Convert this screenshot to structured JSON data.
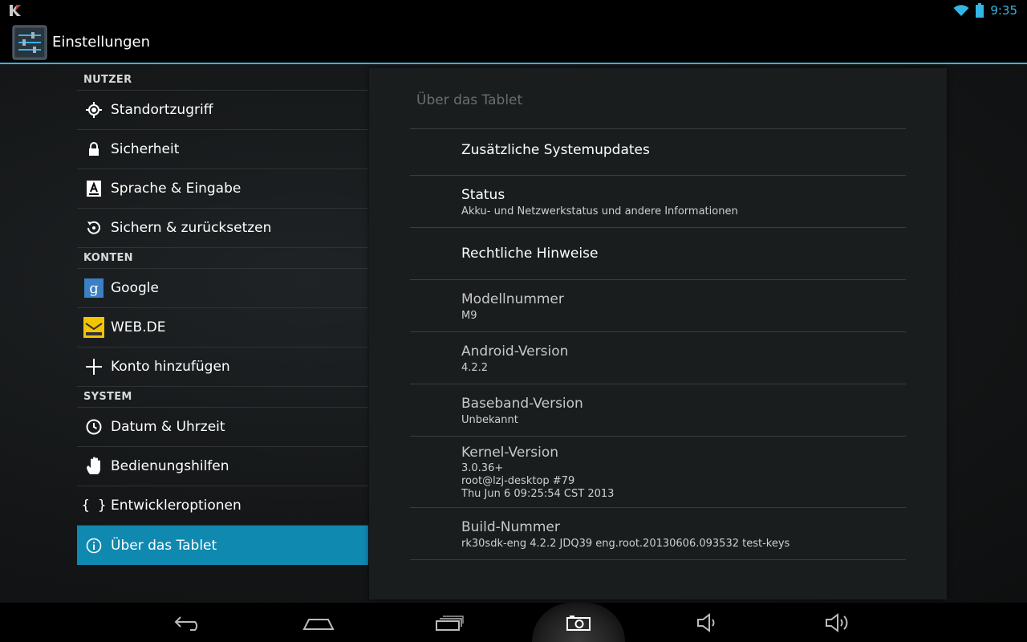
{
  "statusbar": {
    "time": "9:35"
  },
  "actionbar": {
    "title": "Einstellungen"
  },
  "sidebar": {
    "sections": [
      {
        "header": "NUTZER",
        "items": [
          {
            "label": "Standortzugriff",
            "icon": "location-icon"
          },
          {
            "label": "Sicherheit",
            "icon": "lock-icon"
          },
          {
            "label": "Sprache & Eingabe",
            "icon": "keyboard-a-icon"
          },
          {
            "label": "Sichern & zurücksetzen",
            "icon": "restore-icon"
          }
        ]
      },
      {
        "header": "KONTEN",
        "items": [
          {
            "label": "Google",
            "icon": "google-icon"
          },
          {
            "label": "WEB.DE",
            "icon": "webde-icon"
          },
          {
            "label": "Konto hinzufügen",
            "icon": "plus-icon"
          }
        ]
      },
      {
        "header": "SYSTEM",
        "items": [
          {
            "label": "Datum & Uhrzeit",
            "icon": "clock-icon"
          },
          {
            "label": "Bedienungshilfen",
            "icon": "hand-icon"
          },
          {
            "label": "Entwickleroptionen",
            "icon": "braces-icon"
          },
          {
            "label": "Über das Tablet",
            "icon": "info-icon",
            "selected": true
          }
        ]
      }
    ]
  },
  "detail": {
    "title": "Über das Tablet",
    "rows": [
      {
        "title": "Zusätzliche Systemupdates"
      },
      {
        "title": "Status",
        "summary": "Akku- und Netzwerkstatus und andere Informationen"
      },
      {
        "title": "Rechtliche Hinweise"
      },
      {
        "title": "Modellnummer",
        "summary": "M9"
      },
      {
        "title": "Android-Version",
        "summary": "4.2.2"
      },
      {
        "title": "Baseband-Version",
        "summary": "Unbekannt"
      },
      {
        "title": "Kernel-Version",
        "summary_lines": [
          "3.0.36+",
          "root@lzj-desktop #79",
          "Thu Jun 6 09:25:54 CST 2013"
        ]
      },
      {
        "title": "Build-Nummer",
        "summary": "rk30sdk-eng 4.2.2 JDQ39 eng.root.20130606.093532 test-keys"
      }
    ]
  },
  "navbar": {
    "buttons": [
      "back-icon",
      "home-icon",
      "recent-apps-icon",
      "screenshot-icon",
      "volume-down-icon",
      "volume-up-icon"
    ]
  },
  "colors": {
    "accent": "#33b5e5",
    "selected": "#0f89b0"
  }
}
